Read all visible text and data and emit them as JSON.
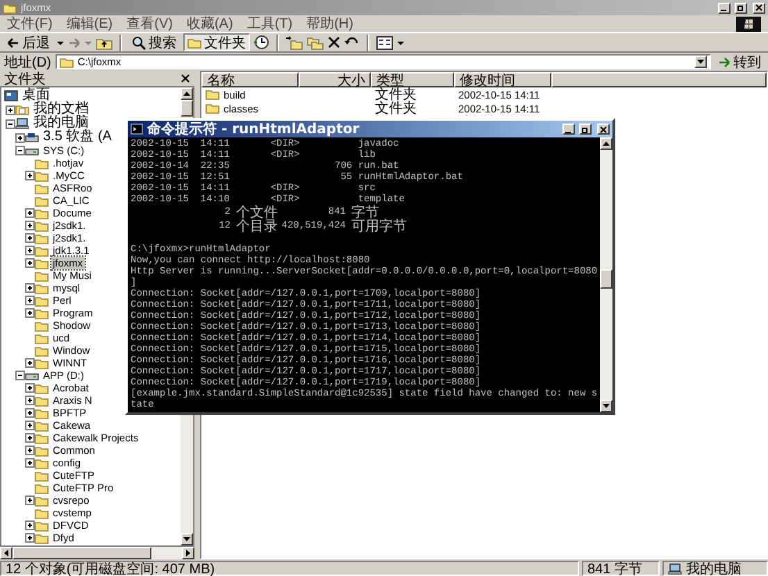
{
  "window": {
    "title": "jfoxmx"
  },
  "menu": [
    "文件(F)",
    "编辑(E)",
    "查看(V)",
    "收藏(A)",
    "工具(T)",
    "帮助(H)"
  ],
  "toolbar": {
    "back": "后退",
    "search": {
      "label": "搜索",
      "pressed": false
    },
    "folders": {
      "label": "文件夹",
      "pressed": true
    }
  },
  "address": {
    "label": "地址(D)",
    "value": "C:\\jfoxmx",
    "go": "转到"
  },
  "folders_pane": {
    "title": "文件夹"
  },
  "tree": [
    {
      "label": "桌面",
      "kind": "desktop",
      "selected": false,
      "children": [
        {
          "label": "我的文档",
          "kind": "documents",
          "expanded": false,
          "selected": false
        },
        {
          "label": "我的电脑",
          "kind": "computer",
          "expanded": true,
          "selected": false,
          "children": [
            {
              "label": "3.5 软盘 (A",
              "kind": "floppy",
              "expanded": false,
              "selected": false
            },
            {
              "label": "SYS (C:)",
              "kind": "drive",
              "expanded": true,
              "selected": false,
              "children": [
                {
                  "label": ".hotjav",
                  "kind": "folder",
                  "selected": false
                },
                {
                  "label": ".MyCC",
                  "kind": "folder",
                  "expanded": false,
                  "selected": false
                },
                {
                  "label": "ASFRoo",
                  "kind": "folder",
                  "selected": false
                },
                {
                  "label": "CA_LIC",
                  "kind": "folder",
                  "selected": false
                },
                {
                  "label": "Docume",
                  "kind": "folder",
                  "expanded": false,
                  "selected": false
                },
                {
                  "label": "j2sdk1.",
                  "kind": "folder",
                  "expanded": false,
                  "selected": false
                },
                {
                  "label": "j2sdk1.",
                  "kind": "folder",
                  "expanded": false,
                  "selected": false
                },
                {
                  "label": "jdk1.3.1",
                  "kind": "folder",
                  "expanded": false,
                  "selected": false
                },
                {
                  "label": "jfoxmx",
                  "kind": "folder",
                  "expanded": false,
                  "selected": true
                },
                {
                  "label": "My Musi",
                  "kind": "folder",
                  "selected": false
                },
                {
                  "label": "mysql",
                  "kind": "folder",
                  "expanded": false,
                  "selected": false
                },
                {
                  "label": "Perl",
                  "kind": "folder",
                  "expanded": false,
                  "selected": false
                },
                {
                  "label": "Program",
                  "kind": "folder",
                  "expanded": false,
                  "selected": false
                },
                {
                  "label": "Shodow",
                  "kind": "folder",
                  "selected": false
                },
                {
                  "label": "ucd",
                  "kind": "folder",
                  "selected": false
                },
                {
                  "label": "Window",
                  "kind": "folder",
                  "selected": false
                },
                {
                  "label": "WINNT",
                  "kind": "folder",
                  "expanded": false,
                  "selected": false
                }
              ]
            },
            {
              "label": "APP (D:)",
              "kind": "drive",
              "expanded": true,
              "selected": false,
              "children": [
                {
                  "label": "Acrobat",
                  "kind": "folder",
                  "expanded": false,
                  "selected": false
                },
                {
                  "label": "Araxis N",
                  "kind": "folder",
                  "expanded": false,
                  "selected": false
                },
                {
                  "label": "BPFTP",
                  "kind": "folder",
                  "expanded": false,
                  "selected": false
                },
                {
                  "label": "Cakewa",
                  "kind": "folder",
                  "expanded": false,
                  "selected": false
                },
                {
                  "label": "Cakewalk Projects",
                  "kind": "folder",
                  "expanded": false,
                  "selected": false
                },
                {
                  "label": "Common",
                  "kind": "folder",
                  "expanded": false,
                  "selected": false
                },
                {
                  "label": "config",
                  "kind": "folder",
                  "expanded": false,
                  "selected": false
                },
                {
                  "label": "CuteFTP",
                  "kind": "folder",
                  "selected": false
                },
                {
                  "label": "CuteFTP Pro",
                  "kind": "folder",
                  "selected": false
                },
                {
                  "label": "cvsrepo",
                  "kind": "folder",
                  "expanded": false,
                  "selected": false
                },
                {
                  "label": "cvstemp",
                  "kind": "folder",
                  "selected": false
                },
                {
                  "label": "DFVCD",
                  "kind": "folder",
                  "expanded": false,
                  "selected": false
                },
                {
                  "label": "Dfyd",
                  "kind": "folder",
                  "expanded": false,
                  "selected": false
                }
              ]
            }
          ]
        }
      ]
    }
  ],
  "file_list": {
    "columns": [
      "名称",
      "大小",
      "类型",
      "修改时间"
    ],
    "rows": [
      {
        "name": "build",
        "type": "文件夹",
        "modified": "2002-10-15 14:11",
        "selected": false
      },
      {
        "name": "classes",
        "type": "文件夹",
        "modified": "2002-10-15 14:11",
        "selected": false
      }
    ]
  },
  "status_bar": {
    "objects": "12 个对象(可用磁盘空间: 407 MB)",
    "size": "841 字节",
    "zone": "我的电脑"
  },
  "console": {
    "title": "命令提示符 - runHtmlAdaptor",
    "lines": [
      {
        "kind": "text",
        "text": "2002-10-15  14:11       <DIR>          javadoc"
      },
      {
        "kind": "text",
        "text": "2002-10-15  14:11       <DIR>          lib"
      },
      {
        "kind": "text",
        "text": "2002-10-14  22:35                  706 run.bat"
      },
      {
        "kind": "text",
        "text": "2002-10-15  12:51                   55 runHtmlAdaptor.bat"
      },
      {
        "kind": "text",
        "text": "2002-10-15  14:11       <DIR>          src"
      },
      {
        "kind": "text",
        "text": "2002-10-15  14:10       <DIR>          template"
      },
      {
        "kind": "summary",
        "count": "2",
        "label": "个文件",
        "amount": "841",
        "unit": "字节"
      },
      {
        "kind": "summary",
        "count": "12",
        "label": "个目录",
        "amount": "420,519,424",
        "unit": "可用字节"
      },
      {
        "kind": "blank"
      },
      {
        "kind": "text",
        "text": "C:\\jfoxmx>runHtmlAdaptor"
      },
      {
        "kind": "text",
        "text": "Now,you can connect http://localhost:8080"
      },
      {
        "kind": "text",
        "text": "Http Server is running...ServerSocket[addr=0.0.0.0/0.0.0.0,port=0,localport=8080"
      },
      {
        "kind": "text",
        "text": "]"
      },
      {
        "kind": "text",
        "text": "Connection: Socket[addr=/127.0.0.1,port=1709,localport=8080]"
      },
      {
        "kind": "text",
        "text": "Connection: Socket[addr=/127.0.0.1,port=1711,localport=8080]"
      },
      {
        "kind": "text",
        "text": "Connection: Socket[addr=/127.0.0.1,port=1712,localport=8080]"
      },
      {
        "kind": "text",
        "text": "Connection: Socket[addr=/127.0.0.1,port=1713,localport=8080]"
      },
      {
        "kind": "text",
        "text": "Connection: Socket[addr=/127.0.0.1,port=1714,localport=8080]"
      },
      {
        "kind": "text",
        "text": "Connection: Socket[addr=/127.0.0.1,port=1715,localport=8080]"
      },
      {
        "kind": "text",
        "text": "Connection: Socket[addr=/127.0.0.1,port=1716,localport=8080]"
      },
      {
        "kind": "text",
        "text": "Connection: Socket[addr=/127.0.0.1,port=1717,localport=8080]"
      },
      {
        "kind": "text",
        "text": "Connection: Socket[addr=/127.0.0.1,port=1719,localport=8080]"
      },
      {
        "kind": "text",
        "text": "[example.jmx.standard.SimpleStandard@1c92535] state field have changed to: new s"
      },
      {
        "kind": "text",
        "text": "tate"
      }
    ]
  }
}
